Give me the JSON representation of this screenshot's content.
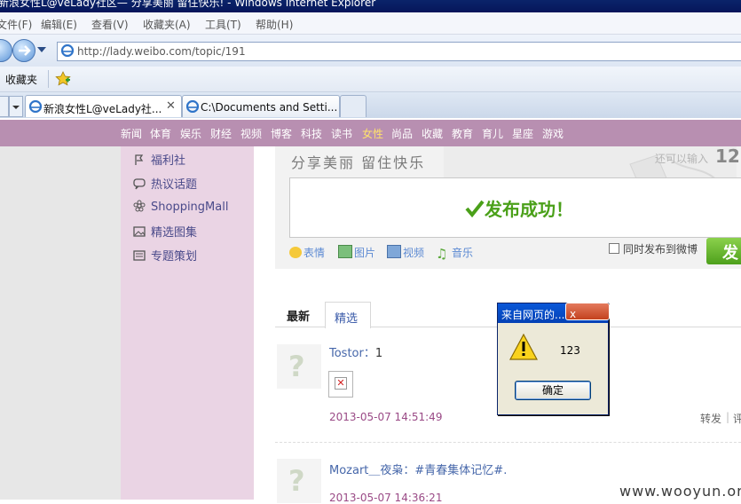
{
  "window": {
    "title": "新浪女性L@veLady社区— 分享美丽 留住快乐! - Windows Internet Explorer"
  },
  "menu": [
    "文件(F)",
    "编辑(E)",
    "查看(V)",
    "收藏夹(A)",
    "工具(T)",
    "帮助(H)"
  ],
  "address": {
    "url": "http://lady.weibo.com/topic/191"
  },
  "favorites": {
    "label": "收藏夹"
  },
  "tabs": [
    {
      "label": "新浪女性L@veLady社..."
    },
    {
      "label": "C:\\Documents and Setti..."
    }
  ],
  "site_nav": [
    "新闻",
    "体育",
    "娱乐",
    "财经",
    "视频",
    "博客",
    "科技",
    "读书",
    "女性",
    "尚品",
    "收藏",
    "教育",
    "育儿",
    "星座",
    "游戏"
  ],
  "site_nav_active": "女性",
  "sidebar": {
    "items": [
      {
        "label": "福利社",
        "icon": "flag-icon"
      },
      {
        "label": "热议话题",
        "icon": "speech-bubble-icon"
      },
      {
        "label": "ShoppingMall",
        "icon": "flower-icon"
      },
      {
        "label": "精选图集",
        "icon": "image-icon"
      },
      {
        "label": "专题策划",
        "icon": "list-icon"
      }
    ]
  },
  "banner": {
    "title": "分享美丽 留住快乐",
    "tip": "还可以输入",
    "count": "12"
  },
  "composer": {
    "success_text": "发布成功！",
    "tools": [
      "表情",
      "图片",
      "视频",
      "音乐"
    ],
    "sync_label": "同时发布到微博",
    "publish_label": "发"
  },
  "feed_tabs": {
    "latest": "最新",
    "featured": "精选"
  },
  "posts": [
    {
      "user": "Tostor：",
      "text": "1",
      "time": "2013-05-07 14:51:49",
      "actions": [
        "转发",
        "评"
      ]
    },
    {
      "user": "Mozart＿夜枭：",
      "text": "#青春集体记忆#.",
      "time": "2013-05-07 14:36:21"
    }
  ],
  "dialog": {
    "title": "来自网页的...",
    "message": "123",
    "ok": "确定",
    "close": "x"
  },
  "watermark": "www.wooyun.org",
  "colors": {
    "site_nav": "#b88fb1",
    "sidebar": "#ead4e4",
    "success": "#4aa019",
    "active_nav": "#ffe36b"
  }
}
